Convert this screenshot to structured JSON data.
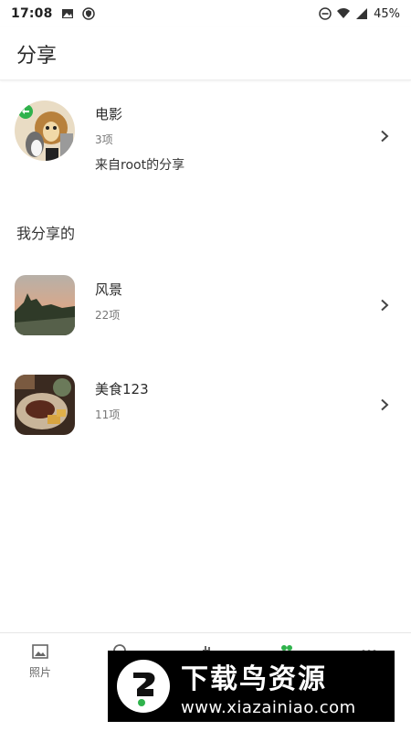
{
  "status_bar": {
    "time": "17:08",
    "battery": "45%"
  },
  "app_bar": {
    "title": "分享"
  },
  "shared_with_me": [
    {
      "name": "电影",
      "count": "3项",
      "from": "来自root的分享"
    }
  ],
  "my_shares_label": "我分享的",
  "my_shares": [
    {
      "name": "风景",
      "count": "22项"
    },
    {
      "name": "美食123",
      "count": "11项"
    }
  ],
  "tab_bar": {
    "tabs": [
      {
        "label": "照片"
      }
    ]
  },
  "watermark": {
    "title": "下载鸟资源",
    "url": "www.xiazainiao.com"
  },
  "colors": {
    "accent": "#2fb24c",
    "background": "#ffffff"
  }
}
